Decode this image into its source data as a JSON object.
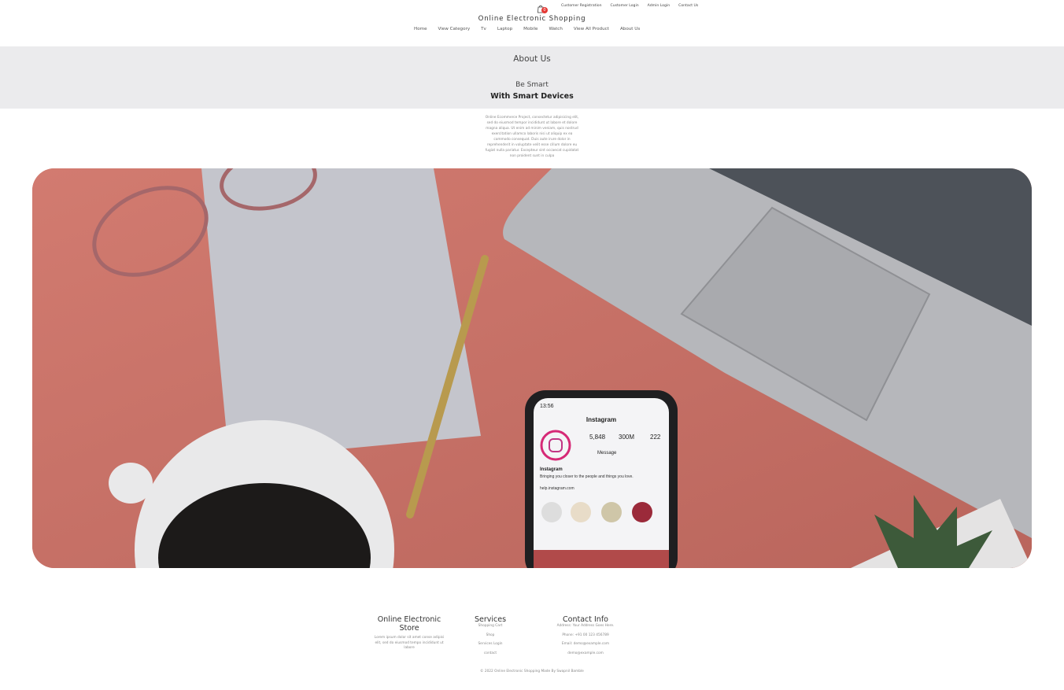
{
  "header": {
    "cart_count": "0",
    "top_links": [
      "Customer Registration",
      "Customer Login",
      "Admin Login",
      "Contact Us"
    ],
    "brand": "Online Electronic Shopping",
    "nav": [
      "Home",
      "View Category",
      "Tv",
      "Laptop",
      "Mobile",
      "Watch",
      "View All Product",
      "About Us"
    ]
  },
  "about": {
    "title": "About Us",
    "tagline_1": "Be Smart",
    "tagline_2": "With Smart Devices",
    "description": "Online Ecommerce Project, consectetur adipisicing elit, sed do eiusmod tempor incididunt ut labore et dolore magna aliqua. Ut enim ad minim veniam, quis nostrud exercitation ullamco laboris nisi ut aliquip ex ea commodo consequat. Duis aute irure dolor in reprehenderit in voluptate velit esse cillum dolore eu fugiat nulla pariatur. Excepteur sint occaecat cupidatat non proident sunt in culpa"
  },
  "hero_image": {
    "phone_app": "Instagram",
    "phone_time": "13:56",
    "posts": "5,848",
    "followers": "300M",
    "following": "222",
    "message_label": "Message",
    "profile_name": "Instagram",
    "bio": "Bringing you closer to the people and things you love.",
    "link": "help.instagram.com"
  },
  "footer": {
    "store": {
      "title": "Online Electronic Store",
      "text": "Lorem ipsum dolor sit amet conse adipisi elit, sed do eiusmod tempo incididunt ut labore"
    },
    "services": {
      "title": "Services",
      "links": [
        "Shopping Cart",
        "Shop",
        "Services Login",
        "contact"
      ]
    },
    "contact": {
      "title": "Contact Info",
      "lines": [
        "Address: Your Address Goes Here.",
        "Phone: +91 00 123 456789",
        "Email: demo@example.com",
        "demo@example.com"
      ]
    },
    "copyright": "© 2022 Online Electronic Shopping Made By Swapnil Bamble"
  },
  "colors": {
    "badge": "#e53935",
    "band": "#ebebed",
    "desk": "#c57066"
  }
}
